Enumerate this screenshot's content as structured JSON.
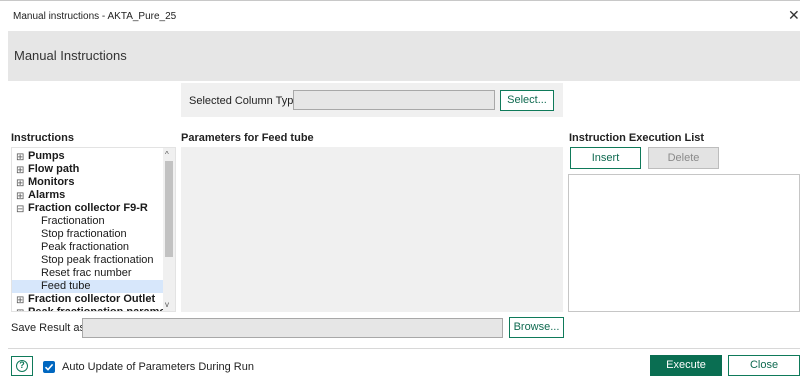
{
  "window": {
    "title": "Manual instructions - AKTA_Pure_25",
    "close_glyph": "✕"
  },
  "header": {
    "title": "Manual Instructions"
  },
  "column_type": {
    "label": "Selected Column Type",
    "value": "",
    "select_label": "Select..."
  },
  "instructions": {
    "heading": "Instructions",
    "tree": [
      {
        "label": "Pumps",
        "expander": "⊞",
        "level": 0
      },
      {
        "label": "Flow path",
        "expander": "⊞",
        "level": 0
      },
      {
        "label": "Monitors",
        "expander": "⊞",
        "level": 0
      },
      {
        "label": "Alarms",
        "expander": "⊞",
        "level": 0
      },
      {
        "label": "Fraction collector F9-R",
        "expander": "⊟",
        "level": 0
      },
      {
        "label": "Fractionation",
        "level": 1
      },
      {
        "label": "Stop fractionation",
        "level": 1
      },
      {
        "label": "Peak fractionation",
        "level": 1
      },
      {
        "label": "Stop peak fractionation",
        "level": 1
      },
      {
        "label": "Reset frac number",
        "level": 1
      },
      {
        "label": "Feed tube",
        "level": 1,
        "selected": true
      },
      {
        "label": "Fraction collector Outlet",
        "expander": "⊞",
        "level": 0
      },
      {
        "label": "Peak fractionation parameters",
        "expander": "⊞",
        "level": 0,
        "partial": true
      }
    ],
    "scroll_up_glyph": "^",
    "scroll_down_glyph": "v"
  },
  "parameters": {
    "heading": "Parameters for Feed tube"
  },
  "execution_list": {
    "heading": "Instruction Execution List",
    "insert_label": "Insert",
    "delete_label": "Delete"
  },
  "save_result": {
    "label": "Save Result as",
    "value": "",
    "browse_label": "Browse..."
  },
  "footer": {
    "help_glyph": "?",
    "auto_update": {
      "label": "Auto Update of Parameters During Run",
      "checked": true
    },
    "execute_label": "Execute",
    "close_label": "Close"
  },
  "colors": {
    "accent": "#0a6e52",
    "checkbox": "#0067c0",
    "selection": "#d7e7fb",
    "panel": "#f0f0f0",
    "header": "#e6e6e6"
  }
}
